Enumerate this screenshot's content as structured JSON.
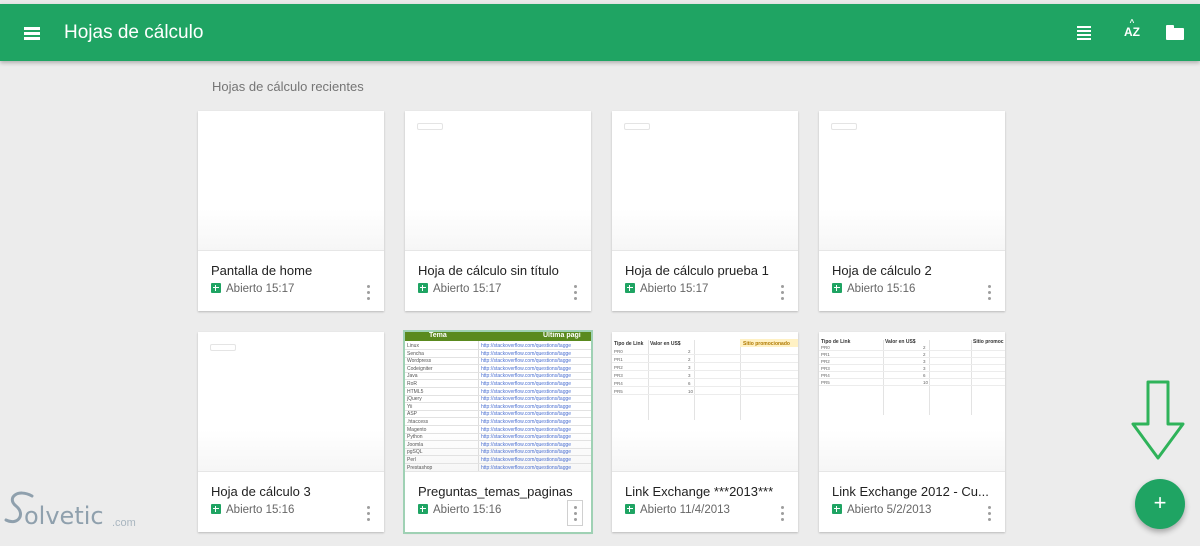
{
  "app": {
    "title": "Hojas de cálculo",
    "brand_color": "#1fa463",
    "icons": [
      "menu-icon",
      "list-view-icon",
      "sort-az-icon",
      "folder-icon"
    ],
    "sort_label": "AZ"
  },
  "section": {
    "title": "Hojas de cálculo recientes"
  },
  "files": [
    {
      "title": "Pantalla de home",
      "meta": "Abierto 15:17"
    },
    {
      "title": "Hoja de cálculo sin título",
      "meta": "Abierto 15:17"
    },
    {
      "title": "Hoja de cálculo prueba 1",
      "meta": "Abierto 15:17"
    },
    {
      "title": "Hoja de cálculo 2",
      "meta": "Abierto 15:16"
    },
    {
      "title": "Hoja de cálculo 3",
      "meta": "Abierto 15:16"
    },
    {
      "title": "Preguntas_temas_paginas",
      "meta": "Abierto 15:16"
    },
    {
      "title": "Link Exchange ***2013***",
      "meta": "Abierto 11/4/2013"
    },
    {
      "title": "Link Exchange 2012 - Cu...",
      "meta": "Abierto 5/2/2013"
    }
  ],
  "thumb_preguntas": {
    "col1": "Tema",
    "col2": "Ultima pagi",
    "rows": [
      "Linux",
      "Sencha",
      "Wordpress",
      "Codeigniter",
      "Java",
      "RoR",
      "HTML5",
      "jQuery",
      "Yii",
      "ASP",
      ".htaccess",
      "Magento",
      "Python",
      "Joomla",
      "pgSQL",
      "Perl",
      "Prestashop"
    ],
    "link": "http://stackoverflow.com/questions/tagge"
  },
  "thumb_link2013": {
    "headers": [
      "Tipo de Link",
      "Valor en US$",
      "Sitio promocionado"
    ],
    "rows": [
      [
        "PR0",
        "2"
      ],
      [
        "PR1",
        "2"
      ],
      [
        "PR2",
        "3"
      ],
      [
        "PR3",
        "3"
      ],
      [
        "PR4",
        "6"
      ],
      [
        "PR5",
        "10"
      ]
    ]
  },
  "thumb_link2012": {
    "headers": [
      "Tipo de Link",
      "Valor en US$",
      "Sitio promoc"
    ],
    "rows": [
      [
        "PR0",
        "2"
      ],
      [
        "PR1",
        "2"
      ],
      [
        "PR2",
        "3"
      ],
      [
        "PR3",
        "3"
      ],
      [
        "PR4",
        "6"
      ],
      [
        "PR5",
        "10"
      ]
    ]
  },
  "fab": {
    "label": "+"
  },
  "watermark": {
    "text": "olvetic",
    "suffix": ".com"
  }
}
